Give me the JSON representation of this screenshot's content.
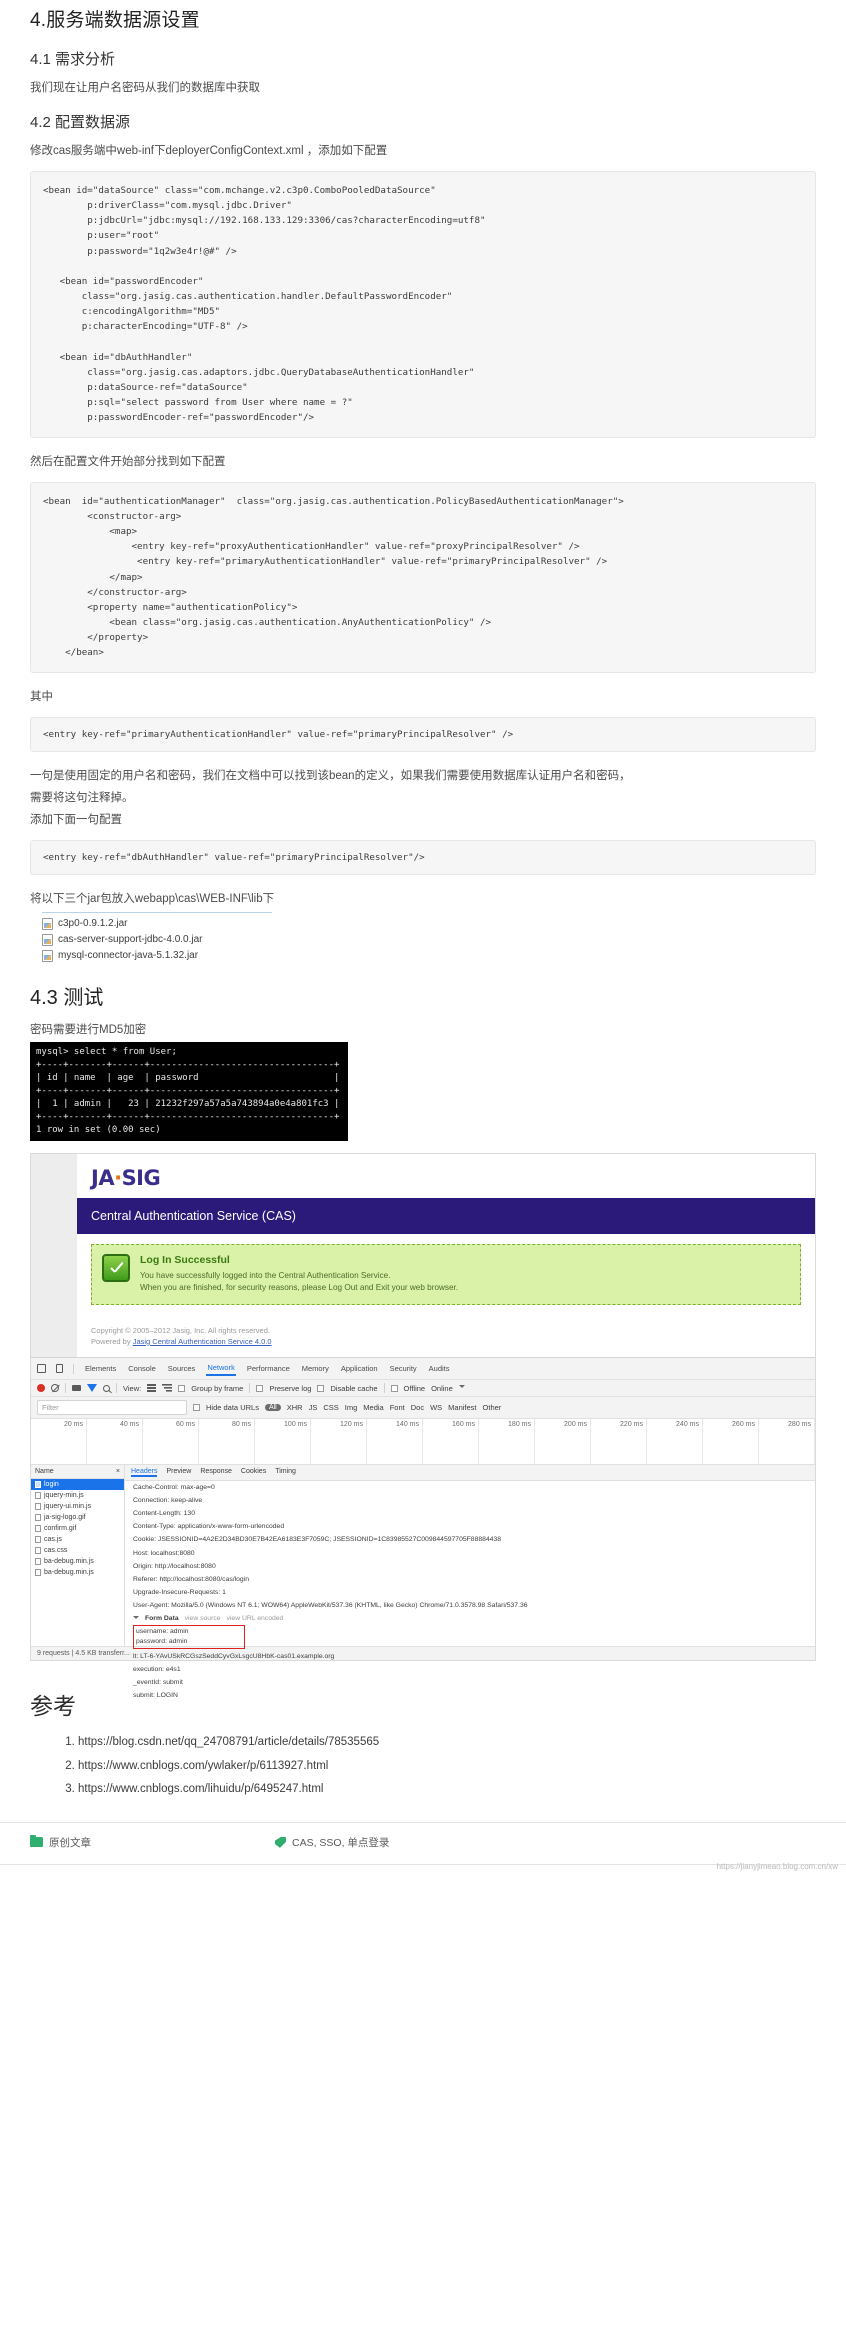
{
  "headings": {
    "h4": "4.服务端数据源设置",
    "h41": "4.1 需求分析",
    "h42": "4.2 配置数据源",
    "h43": "4.3 测试",
    "references": "参考"
  },
  "paragraphs": {
    "p41": "我们现在让用户名密码从我们的数据库中获取",
    "p42": "修改cas服务端中web-inf下deployerConfigContext.xml ，添加如下配置",
    "p_then": "然后在配置文件开始部分找到如下配置",
    "p_among": "其中",
    "p_explain_1": "一句是使用固定的用户名和密码，我们在文档中可以找到该bean的定义，如果我们需要使用数据库认证用户名和密码，",
    "p_explain_2": "需要将这句注释掉。",
    "p_add": "添加下面一句配置",
    "p_jars": "将以下三个jar包放入webapp\\cas\\WEB-INF\\lib下",
    "p_md5": "密码需要进行MD5加密"
  },
  "code_blocks": {
    "datasource": "<bean id=\"dataSource\" class=\"com.mchange.v2.c3p0.ComboPooledDataSource\"\n        p:driverClass=\"com.mysql.jdbc.Driver\"\n        p:jdbcUrl=\"jdbc:mysql://192.168.133.129:3306/cas?characterEncoding=utf8\"\n        p:user=\"root\"\n        p:password=\"1q2w3e4r!@#\" />\n\n   <bean id=\"passwordEncoder\"\n       class=\"org.jasig.cas.authentication.handler.DefaultPasswordEncoder\"\n       c:encodingAlgorithm=\"MD5\"\n       p:characterEncoding=\"UTF-8\" />\n\n   <bean id=\"dbAuthHandler\"\n        class=\"org.jasig.cas.adaptors.jdbc.QueryDatabaseAuthenticationHandler\"\n        p:dataSource-ref=\"dataSource\"\n        p:sql=\"select password from User where name = ?\"\n        p:passwordEncoder-ref=\"passwordEncoder\"/>",
    "authmanager": "<bean  id=\"authenticationManager\"  class=\"org.jasig.cas.authentication.PolicyBasedAuthenticationManager\">\n        <constructor-arg>\n            <map>\n                <entry key-ref=\"proxyAuthenticationHandler\" value-ref=\"proxyPrincipalResolver\" />\n                 <entry key-ref=\"primaryAuthenticationHandler\" value-ref=\"primaryPrincipalResolver\" />\n            </map>\n        </constructor-arg>\n        <property name=\"authenticationPolicy\">\n            <bean class=\"org.jasig.cas.authentication.AnyAuthenticationPolicy\" />\n        </property>\n    </bean>",
    "entry_primary": "<entry key-ref=\"primaryAuthenticationHandler\" value-ref=\"primaryPrincipalResolver\" />",
    "entry_dbauth": "<entry key-ref=\"dbAuthHandler\" value-ref=\"primaryPrincipalResolver\"/>"
  },
  "jar_files": [
    "c3p0-0.9.1.2.jar",
    "cas-server-support-jdbc-4.0.0.jar",
    "mysql-connector-java-5.1.32.jar"
  ],
  "terminal": {
    "lines": "mysql> select * from User;\n+----+-------+------+----------------------------------+\n| id | name  | age  | password                         |\n+----+-------+------+----------------------------------+\n|  1 | admin |   23 | 21232f297a57a5a743894a0e4a801fc3 |\n+----+-------+------+----------------------------------+\n1 row in set (0.00 sec)"
  },
  "cas_screenshot": {
    "logo_left": "JA",
    "logo_dot": "·",
    "logo_right": "SIG",
    "banner": "Central Authentication Service (CAS)",
    "success_title": "Log In Successful",
    "success_line1": "You have successfully logged into the Central Authentication Service.",
    "success_line2": "When you are finished, for security reasons, please Log Out and Exit your web browser.",
    "copyright": "Copyright © 2005–2012 Jasig, Inc. All rights reserved.",
    "powered_prefix": "Powered by ",
    "powered_link": "Jasig Central Authentication Service 4.0.0",
    "banner_color": "#2b1a7a",
    "success_bg": "#d9f2a8"
  },
  "devtools": {
    "tabs": [
      "Elements",
      "Console",
      "Sources",
      "Network",
      "Performance",
      "Memory",
      "Application",
      "Security",
      "Audits"
    ],
    "active_tab": "Network",
    "toolbar": {
      "view_label": "View:",
      "group_by_frame": "Group by frame",
      "preserve_log": "Preserve log",
      "disable_cache": "Disable cache",
      "offline": "Offline",
      "throttle": "Online"
    },
    "filter": {
      "placeholder": "Filter",
      "hide_data_urls": "Hide data URLs",
      "all": "All",
      "types": [
        "XHR",
        "JS",
        "CSS",
        "Img",
        "Media",
        "Font",
        "Doc",
        "WS",
        "Manifest",
        "Other"
      ]
    },
    "timeline_ticks": [
      "20 ms",
      "40 ms",
      "60 ms",
      "80 ms",
      "100 ms",
      "120 ms",
      "140 ms",
      "160 ms",
      "180 ms",
      "200 ms",
      "220 ms",
      "240 ms",
      "260 ms",
      "280 ms"
    ],
    "left_header": {
      "name": "Name",
      "x": "×"
    },
    "files": [
      "login",
      "jquery-min.js",
      "jquery-ui.min.js",
      "ja-sig-logo.gif",
      "confirm.gif",
      "cas.js",
      "cas.css",
      "ba-debug.min.js",
      "ba-debug.min.js"
    ],
    "selected_file": "login",
    "right_tabs": [
      "Headers",
      "Preview",
      "Response",
      "Cookies",
      "Timing"
    ],
    "active_right_tab": "Headers",
    "headers": [
      "Cache-Control: max-age=0",
      "Connection: keep-alive",
      "Content-Length: 130",
      "Content-Type: application/x-www-form-urlencoded",
      "Cookie: JSESSIONID=4A2E2D34BD30E7B42EA6183E3F7059C; JSESSIONID=1C83985527C009844597705F88884438",
      "Host: localhost:8080",
      "Origin: http://localhost:8080",
      "Referer: http://localhost:8080/cas/login",
      "Upgrade-Insecure-Requests: 1",
      "User-Agent: Mozilla/5.0 (Windows NT 6.1; WOW64) AppleWebKit/537.36 (KHTML, like Gecko) Chrome/71.0.3578.98 Safari/537.36"
    ],
    "form_data_label": "Form Data",
    "form_data_actions": [
      "view source",
      "view URL encoded"
    ],
    "form_fields": [
      "username: admin",
      "password: admin",
      "lt: LT-6-YAvUSkRCGszSeddCyvGxLsgcU8HbK-cas01.example.org",
      "execution: e4s1",
      "_eventId: submit",
      "submit: LOGIN"
    ],
    "status": "9 requests | 4.5 KB transferr..."
  },
  "references": [
    "https://blog.csdn.net/qq_24708791/article/details/78535565",
    "https://www.cnblogs.com/ywlaker/p/6113927.html",
    "https://www.cnblogs.com/lihuidu/p/6495247.html"
  ],
  "footer": {
    "category_icon": "folder-icon",
    "category": "原创文章",
    "tag_icon": "tag-icon",
    "tags": "CAS, SSO, 单点登录"
  },
  "watermark": "https://jianyjimeao.blog.com.cn/xw"
}
